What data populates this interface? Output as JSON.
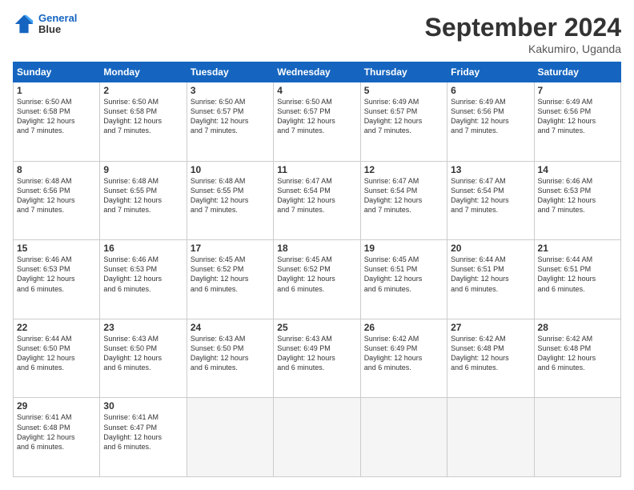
{
  "logo": {
    "line1": "General",
    "line2": "Blue"
  },
  "title": "September 2024",
  "subtitle": "Kakumiro, Uganda",
  "days_header": [
    "Sunday",
    "Monday",
    "Tuesday",
    "Wednesday",
    "Thursday",
    "Friday",
    "Saturday"
  ],
  "weeks": [
    [
      {
        "day": "1",
        "info": "Sunrise: 6:50 AM\nSunset: 6:58 PM\nDaylight: 12 hours\nand 7 minutes."
      },
      {
        "day": "2",
        "info": "Sunrise: 6:50 AM\nSunset: 6:58 PM\nDaylight: 12 hours\nand 7 minutes."
      },
      {
        "day": "3",
        "info": "Sunrise: 6:50 AM\nSunset: 6:57 PM\nDaylight: 12 hours\nand 7 minutes."
      },
      {
        "day": "4",
        "info": "Sunrise: 6:50 AM\nSunset: 6:57 PM\nDaylight: 12 hours\nand 7 minutes."
      },
      {
        "day": "5",
        "info": "Sunrise: 6:49 AM\nSunset: 6:57 PM\nDaylight: 12 hours\nand 7 minutes."
      },
      {
        "day": "6",
        "info": "Sunrise: 6:49 AM\nSunset: 6:56 PM\nDaylight: 12 hours\nand 7 minutes."
      },
      {
        "day": "7",
        "info": "Sunrise: 6:49 AM\nSunset: 6:56 PM\nDaylight: 12 hours\nand 7 minutes."
      }
    ],
    [
      {
        "day": "8",
        "info": "Sunrise: 6:48 AM\nSunset: 6:56 PM\nDaylight: 12 hours\nand 7 minutes."
      },
      {
        "day": "9",
        "info": "Sunrise: 6:48 AM\nSunset: 6:55 PM\nDaylight: 12 hours\nand 7 minutes."
      },
      {
        "day": "10",
        "info": "Sunrise: 6:48 AM\nSunset: 6:55 PM\nDaylight: 12 hours\nand 7 minutes."
      },
      {
        "day": "11",
        "info": "Sunrise: 6:47 AM\nSunset: 6:54 PM\nDaylight: 12 hours\nand 7 minutes."
      },
      {
        "day": "12",
        "info": "Sunrise: 6:47 AM\nSunset: 6:54 PM\nDaylight: 12 hours\nand 7 minutes."
      },
      {
        "day": "13",
        "info": "Sunrise: 6:47 AM\nSunset: 6:54 PM\nDaylight: 12 hours\nand 7 minutes."
      },
      {
        "day": "14",
        "info": "Sunrise: 6:46 AM\nSunset: 6:53 PM\nDaylight: 12 hours\nand 7 minutes."
      }
    ],
    [
      {
        "day": "15",
        "info": "Sunrise: 6:46 AM\nSunset: 6:53 PM\nDaylight: 12 hours\nand 6 minutes."
      },
      {
        "day": "16",
        "info": "Sunrise: 6:46 AM\nSunset: 6:53 PM\nDaylight: 12 hours\nand 6 minutes."
      },
      {
        "day": "17",
        "info": "Sunrise: 6:45 AM\nSunset: 6:52 PM\nDaylight: 12 hours\nand 6 minutes."
      },
      {
        "day": "18",
        "info": "Sunrise: 6:45 AM\nSunset: 6:52 PM\nDaylight: 12 hours\nand 6 minutes."
      },
      {
        "day": "19",
        "info": "Sunrise: 6:45 AM\nSunset: 6:51 PM\nDaylight: 12 hours\nand 6 minutes."
      },
      {
        "day": "20",
        "info": "Sunrise: 6:44 AM\nSunset: 6:51 PM\nDaylight: 12 hours\nand 6 minutes."
      },
      {
        "day": "21",
        "info": "Sunrise: 6:44 AM\nSunset: 6:51 PM\nDaylight: 12 hours\nand 6 minutes."
      }
    ],
    [
      {
        "day": "22",
        "info": "Sunrise: 6:44 AM\nSunset: 6:50 PM\nDaylight: 12 hours\nand 6 minutes."
      },
      {
        "day": "23",
        "info": "Sunrise: 6:43 AM\nSunset: 6:50 PM\nDaylight: 12 hours\nand 6 minutes."
      },
      {
        "day": "24",
        "info": "Sunrise: 6:43 AM\nSunset: 6:50 PM\nDaylight: 12 hours\nand 6 minutes."
      },
      {
        "day": "25",
        "info": "Sunrise: 6:43 AM\nSunset: 6:49 PM\nDaylight: 12 hours\nand 6 minutes."
      },
      {
        "day": "26",
        "info": "Sunrise: 6:42 AM\nSunset: 6:49 PM\nDaylight: 12 hours\nand 6 minutes."
      },
      {
        "day": "27",
        "info": "Sunrise: 6:42 AM\nSunset: 6:48 PM\nDaylight: 12 hours\nand 6 minutes."
      },
      {
        "day": "28",
        "info": "Sunrise: 6:42 AM\nSunset: 6:48 PM\nDaylight: 12 hours\nand 6 minutes."
      }
    ],
    [
      {
        "day": "29",
        "info": "Sunrise: 6:41 AM\nSunset: 6:48 PM\nDaylight: 12 hours\nand 6 minutes."
      },
      {
        "day": "30",
        "info": "Sunrise: 6:41 AM\nSunset: 6:47 PM\nDaylight: 12 hours\nand 6 minutes."
      },
      {
        "day": "",
        "info": ""
      },
      {
        "day": "",
        "info": ""
      },
      {
        "day": "",
        "info": ""
      },
      {
        "day": "",
        "info": ""
      },
      {
        "day": "",
        "info": ""
      }
    ]
  ]
}
